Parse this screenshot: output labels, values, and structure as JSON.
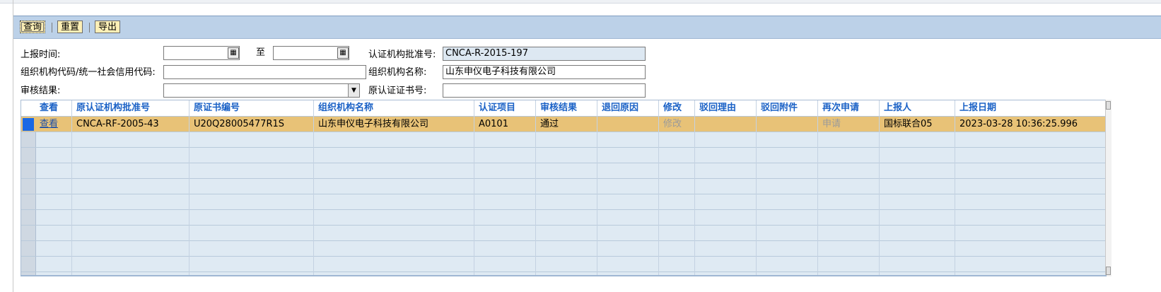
{
  "toolbar": {
    "query_label": "查询",
    "reset_label": "重置",
    "export_label": "导出"
  },
  "form": {
    "report_time_label": "上报时间:",
    "to_label": "至",
    "report_time_from": "",
    "report_time_to": "",
    "cert_body_approval_label": "认证机构批准号:",
    "cert_body_approval_value": "CNCA-R-2015-197",
    "org_code_label": "组织机构代码/统一社会信用代码:",
    "org_code_value": "",
    "org_name_label": "组织机构名称:",
    "org_name_value": "山东申仪电子科技有限公司",
    "review_result_label": "审核结果:",
    "review_result_value": "",
    "orig_cert_no_label": "原认证证书号:",
    "orig_cert_no_value": ""
  },
  "table": {
    "columns": [
      "查看",
      "原认证机构批准号",
      "原证书编号",
      "组织机构名称",
      "认证项目",
      "审核结果",
      "退回原因",
      "修改",
      "驳回理由",
      "驳回附件",
      "再次申请",
      "上报人",
      "上报日期"
    ],
    "rows": [
      {
        "view": "查看",
        "orig_approval_no": "CNCA-RF-2005-43",
        "orig_cert_no": "U20Q28005477R1S",
        "org_name": "山东申仪电子科技有限公司",
        "cert_item": "A0101",
        "review_result": "通过",
        "return_reason": "",
        "modify": "修改",
        "reject_reason": "",
        "reject_attachment": "",
        "reapply": "申请",
        "reporter": "国标联合05",
        "report_date": "2023-03-28 10:36:25.996"
      }
    ]
  },
  "icons": {
    "calendar": "calendar-icon",
    "dropdown": "chevron-down-icon"
  },
  "colors": {
    "header_text": "#1a61c6",
    "selected_row": "#e8c277",
    "toolbar_bg": "#bcd1e8",
    "button_bg": "#fdefb6",
    "row_marker": "#1968e5"
  }
}
